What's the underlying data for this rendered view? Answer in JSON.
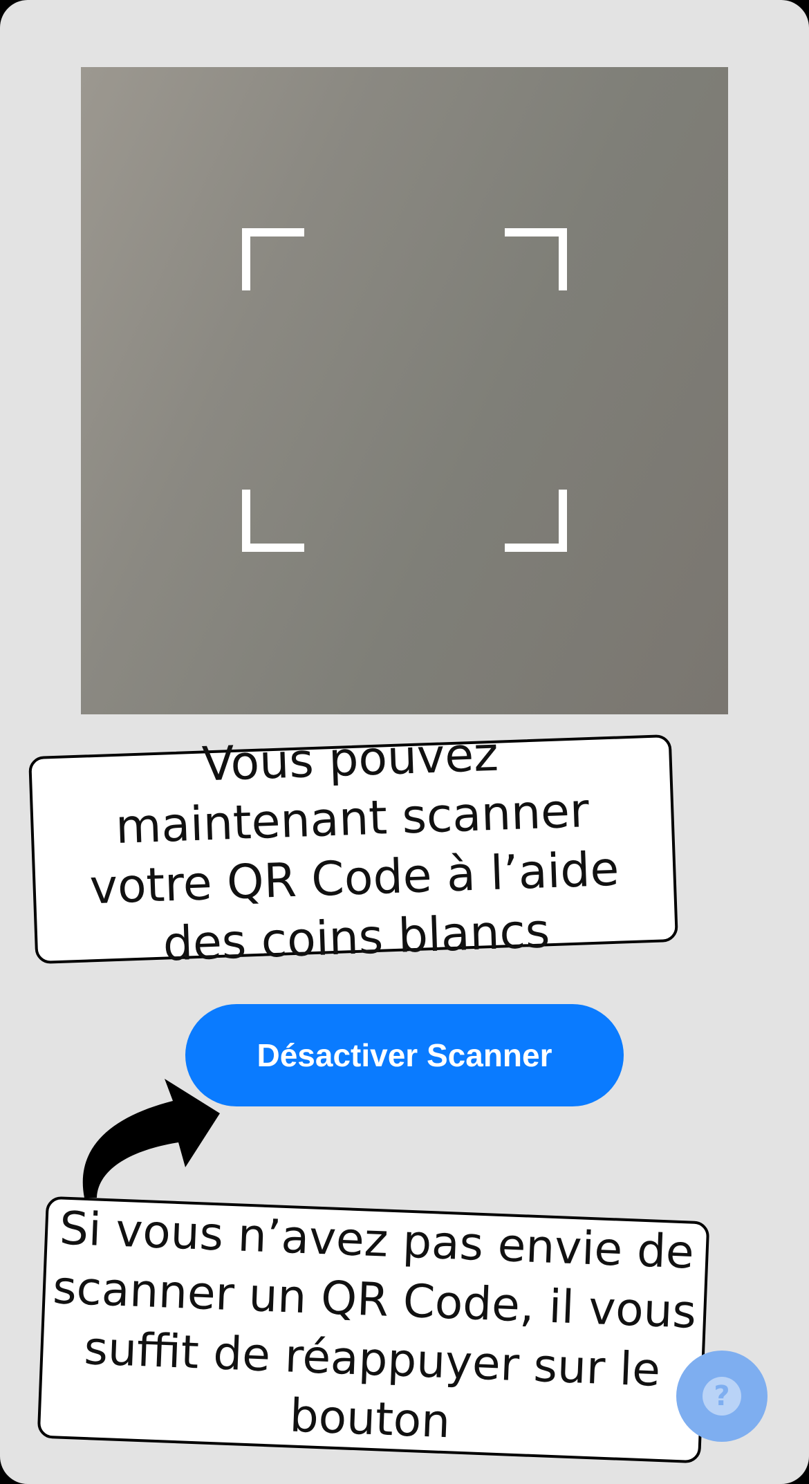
{
  "scanner": {
    "frame_icon": "qr-scan-frame-corners"
  },
  "tips": {
    "scan_tip": "Vous pouvez maintenant scanner votre QR Code à l’aide des coins blancs",
    "toggle_tip": "Si vous n’avez pas envie de scanner un QR Code, il vous suffit de réappuyer sur le bouton"
  },
  "actions": {
    "toggle_scanner_label": "Désactiver Scanner"
  },
  "help": {
    "icon": "question-mark-icon",
    "glyph": "?"
  },
  "colors": {
    "accent": "#0a7bff",
    "help_button": "#7eaef0",
    "background": "#e3e3e3"
  }
}
